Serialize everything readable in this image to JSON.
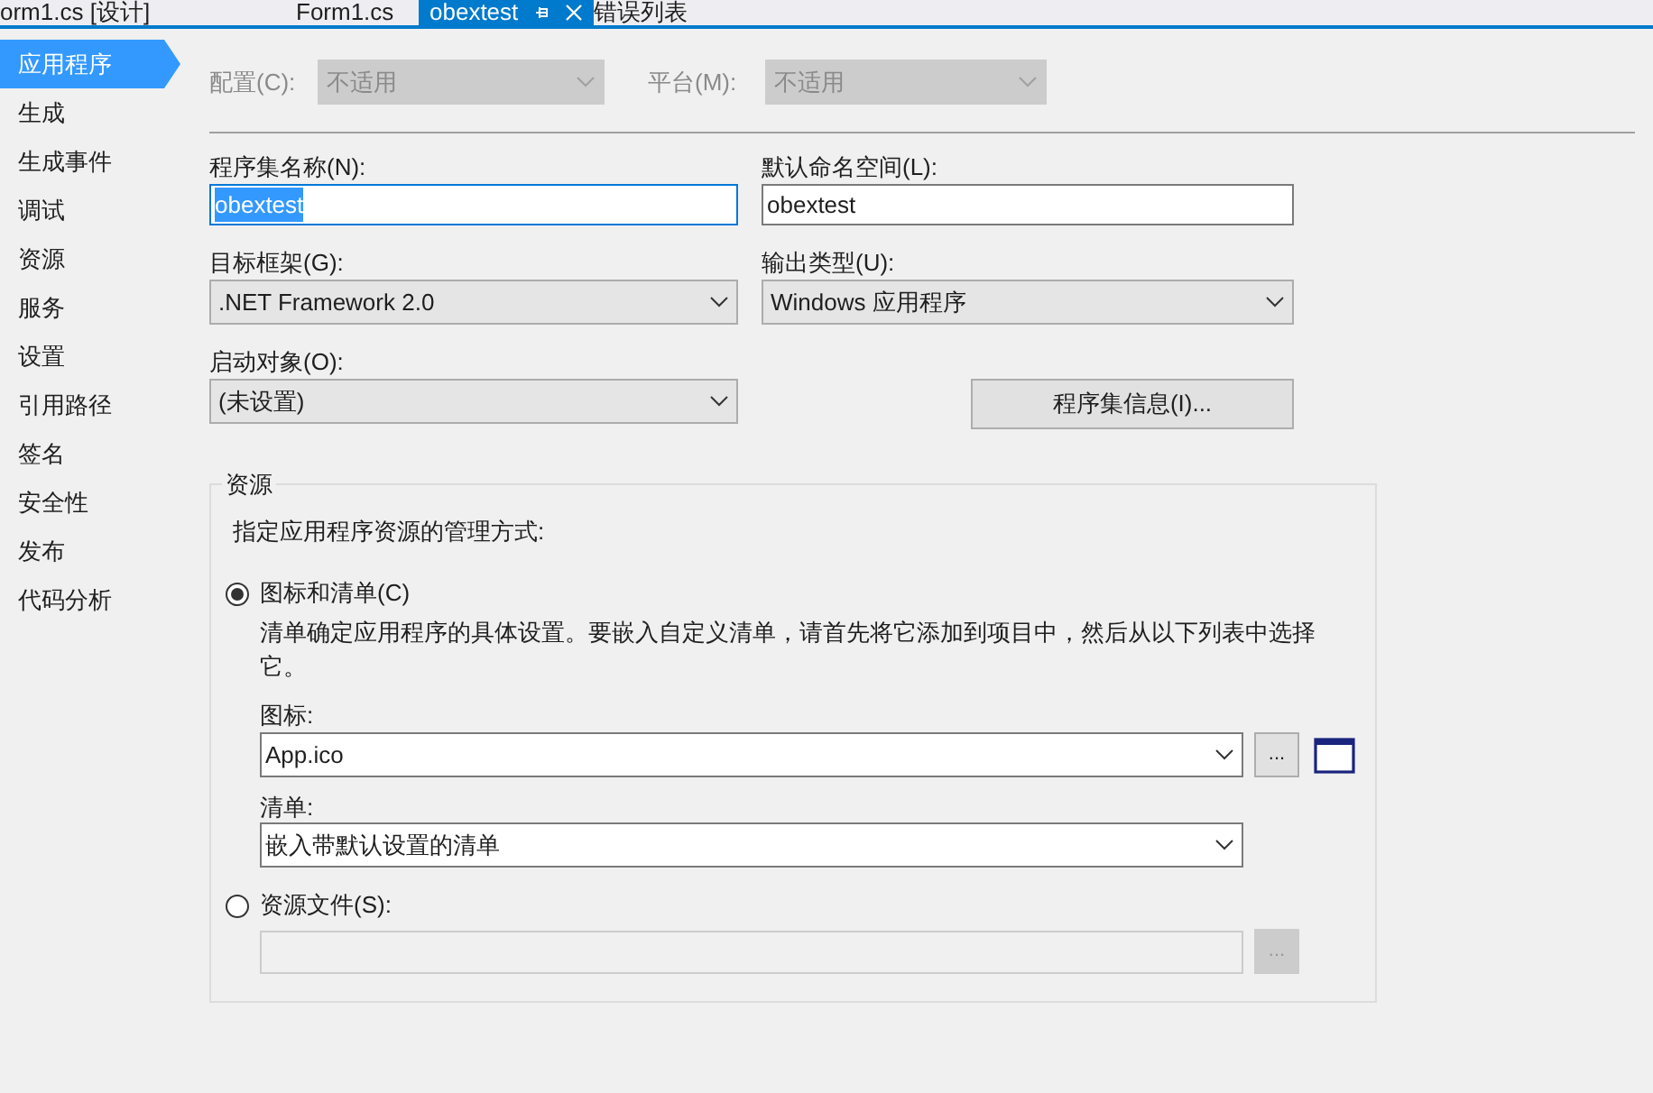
{
  "tabs": [
    {
      "label": "orm1.cs [设计]",
      "selected": false
    },
    {
      "label": "Form1.cs",
      "selected": false
    },
    {
      "label": "obextest",
      "selected": true
    },
    {
      "label": "错误列表",
      "selected": false
    }
  ],
  "sidebar": {
    "items": [
      {
        "label": "应用程序",
        "selected": true
      },
      {
        "label": "生成",
        "selected": false
      },
      {
        "label": "生成事件",
        "selected": false
      },
      {
        "label": "调试",
        "selected": false
      },
      {
        "label": "资源",
        "selected": false
      },
      {
        "label": "服务",
        "selected": false
      },
      {
        "label": "设置",
        "selected": false
      },
      {
        "label": "引用路径",
        "selected": false
      },
      {
        "label": "签名",
        "selected": false
      },
      {
        "label": "安全性",
        "selected": false
      },
      {
        "label": "发布",
        "selected": false
      },
      {
        "label": "代码分析",
        "selected": false
      }
    ]
  },
  "configuration": {
    "label": "配置(C):",
    "value": "不适用",
    "disabled": true
  },
  "platform": {
    "label": "平台(M):",
    "value": "不适用",
    "disabled": true
  },
  "assembly_name": {
    "label": "程序集名称(N):",
    "value": "obextest",
    "focused": true
  },
  "default_namespace": {
    "label": "默认命名空间(L):",
    "value": "obextest",
    "focused": false
  },
  "target_framework": {
    "label": "目标框架(G):",
    "value": ".NET Framework 2.0"
  },
  "output_type": {
    "label": "输出类型(U):",
    "value": "Windows 应用程序"
  },
  "startup_object": {
    "label": "启动对象(O):",
    "value": "(未设置)"
  },
  "assembly_info_button": "程序集信息(I)...",
  "resources": {
    "title": "资源",
    "description": "指定应用程序资源的管理方式:",
    "options": [
      {
        "label": "图标和清单(C)",
        "selected": true
      },
      {
        "label": "资源文件(S):",
        "selected": false
      }
    ],
    "manifest_note": "清单确定应用程序的具体设置。要嵌入自定义清单，请首先将它添加到项目中，然后从以下列表中选择它。",
    "icon": {
      "label": "图标:",
      "value": "App.ico",
      "browse": "..."
    },
    "manifest": {
      "label": "清单:",
      "value": "嵌入带默认设置的清单"
    },
    "resource_file": {
      "browse": "..."
    }
  }
}
